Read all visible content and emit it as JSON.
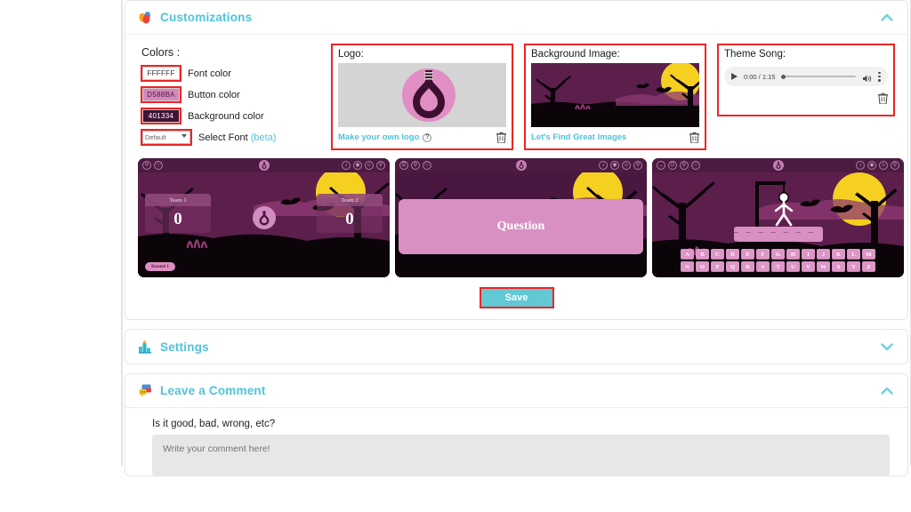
{
  "sections": {
    "customizations": {
      "title": "Customizations",
      "icon": "palette-droplets-icon",
      "chevron": "chevron-up-icon"
    },
    "settings": {
      "title": "Settings",
      "icon": "settings-chart-icon",
      "chevron": "chevron-down-icon"
    },
    "comment": {
      "title": "Leave a Comment",
      "icon": "comment-bubbles-icon",
      "chevron": "chevron-up-icon"
    }
  },
  "colors": {
    "heading": "Colors :",
    "font_color": {
      "value": "FFFFFF",
      "label": "Font color",
      "swatch": "#FFFFFF",
      "text_color": "#333333"
    },
    "button_color": {
      "value": "D588BA",
      "label": "Button color",
      "swatch": "#D588BA",
      "text_color": "#4a2040"
    },
    "background_color": {
      "value": "401334",
      "label": "Background color",
      "swatch": "#401334",
      "text_color": "#FFFFFF"
    },
    "font_select": {
      "value": "Default",
      "label": "Select Font",
      "beta": "(beta)",
      "options": [
        "Default"
      ]
    }
  },
  "logo": {
    "label": "Logo:",
    "link": "Make your own logo",
    "help": "?",
    "delete_icon": "trash-icon"
  },
  "background_image": {
    "label": "Background Image:",
    "link": "Let's Find Great Images",
    "delete_icon": "trash-icon"
  },
  "theme_song": {
    "label": "Theme Song:",
    "time": "0:00 / 1:15",
    "play_icon": "play-icon",
    "volume_icon": "volume-icon",
    "more_icon": "more-options-icon",
    "delete_icon": "trash-icon"
  },
  "previews": {
    "scoreboard": {
      "left_icons": [
        "trophy-icon",
        "info-icon"
      ],
      "right_icons": [
        "music-icon",
        "volume-icon",
        "profile-icon",
        "search-icon"
      ],
      "team1_name": "Team 1",
      "team1_score": "0",
      "team2_name": "Team 2",
      "team2_score": "0",
      "round_badge": "Round 1"
    },
    "question": {
      "left_icons": [
        "menu-icon",
        "trophy-icon",
        "info-icon"
      ],
      "right_icons": [
        "music-icon",
        "volume-icon",
        "profile-icon",
        "search-icon"
      ],
      "card_text": "Question"
    },
    "hangman": {
      "left_icons": [
        "arrow-right-icon",
        "grid-icon",
        "trophy-icon",
        "info-icon"
      ],
      "right_icons": [
        "music-icon",
        "volume-icon",
        "profile-icon",
        "search-icon"
      ],
      "word_placeholder": "_ _ _ _ _ _ _ _",
      "keyboard_row1": [
        "A",
        "B",
        "C",
        "D",
        "E",
        "F",
        "G",
        "H",
        "I",
        "J",
        "K",
        "L",
        "M"
      ],
      "keyboard_row2": [
        "N",
        "O",
        "P",
        "Q",
        "R",
        "S",
        "T",
        "U",
        "V",
        "W",
        "X",
        "Y",
        "Z"
      ]
    }
  },
  "save": {
    "label": "Save"
  },
  "comment": {
    "question": "Is it good, bad, wrong, etc?",
    "placeholder": "Write your comment here!",
    "value": ""
  },
  "theme": {
    "accent_teal": "#4fc3d9",
    "highlight_red": "#ef2424",
    "save_teal": "#62c8d4",
    "scene_dark": "#1a0a17",
    "scene_purple": "#5c1f4c",
    "scene_pink": "#8e3a72",
    "moon_yellow": "#f5d020",
    "btn_pink": "#d588ba"
  }
}
